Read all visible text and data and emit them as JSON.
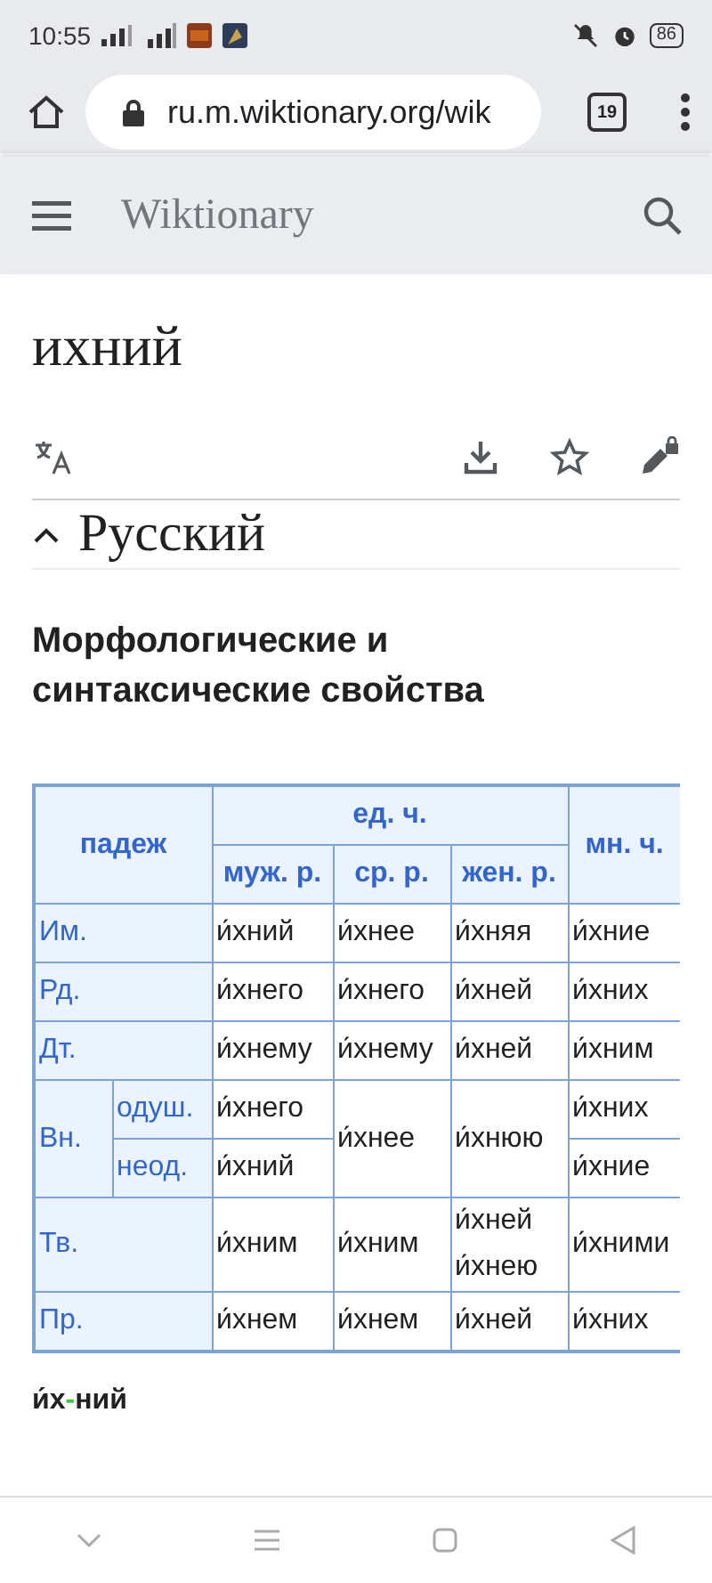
{
  "status_bar": {
    "time": "10:55",
    "battery": "86"
  },
  "browser": {
    "url": "ru.m.wiktionary.org/wik",
    "tab_count": "19"
  },
  "site_header": {
    "title": "Wiktionary"
  },
  "page": {
    "title": "ихний"
  },
  "section": {
    "title": "Русский",
    "expanded": true
  },
  "heading": "Морфологические и синтаксические свойства",
  "table": {
    "rows": [
      [
        {
          "kind": "head",
          "text": "падеж",
          "rowspan": 2,
          "colspan": 2
        },
        {
          "kind": "head",
          "text": "ед. ч.",
          "colspan": 3
        },
        {
          "kind": "head",
          "text": "мн. ч.",
          "rowspan": 2
        }
      ],
      [
        {
          "kind": "head",
          "text": "муж. р."
        },
        {
          "kind": "head",
          "text": "ср. р."
        },
        {
          "kind": "head",
          "text": "жен. р."
        }
      ],
      [
        {
          "kind": "case",
          "text": "Им.",
          "colspan": 2
        },
        {
          "kind": "form",
          "text": "и́хний"
        },
        {
          "kind": "form",
          "text": "и́хнее"
        },
        {
          "kind": "form",
          "text": "и́хняя"
        },
        {
          "kind": "form",
          "text": "и́хние"
        }
      ],
      [
        {
          "kind": "case",
          "text": "Рд.",
          "colspan": 2
        },
        {
          "kind": "form",
          "text": "и́хнего"
        },
        {
          "kind": "form",
          "text": "и́хнего"
        },
        {
          "kind": "form",
          "text": "и́хней"
        },
        {
          "kind": "form",
          "text": "и́хних"
        }
      ],
      [
        {
          "kind": "case",
          "text": "Дт.",
          "colspan": 2
        },
        {
          "kind": "form",
          "text": "и́хнему"
        },
        {
          "kind": "form",
          "text": "и́хнему"
        },
        {
          "kind": "form",
          "text": "и́хней"
        },
        {
          "kind": "form",
          "text": "и́хним"
        }
      ],
      [
        {
          "kind": "case",
          "text": "Вн.",
          "rowspan": 2
        },
        {
          "kind": "case",
          "text": "одуш."
        },
        {
          "kind": "form",
          "text": "и́хнего"
        },
        {
          "kind": "form",
          "text": "и́хнее",
          "rowspan": 2
        },
        {
          "kind": "form",
          "text": "и́хнюю",
          "rowspan": 2
        },
        {
          "kind": "form",
          "text": "и́хних"
        }
      ],
      [
        {
          "kind": "case",
          "text": "неод."
        },
        {
          "kind": "form",
          "text": "и́хний"
        },
        {
          "kind": "form",
          "text": "и́хние"
        }
      ],
      [
        {
          "kind": "case",
          "text": "Тв.",
          "colspan": 2
        },
        {
          "kind": "form",
          "text": "и́хним"
        },
        {
          "kind": "form",
          "text": "и́хним"
        },
        {
          "kind": "form",
          "lines": [
            "и́хней",
            "и́хнею"
          ]
        },
        {
          "kind": "form",
          "text": "и́хними"
        }
      ],
      [
        {
          "kind": "case",
          "text": "Пр.",
          "colspan": 2
        },
        {
          "kind": "form",
          "text": "и́хнем"
        },
        {
          "kind": "form",
          "text": "и́хнем"
        },
        {
          "kind": "form",
          "text": "и́хней"
        },
        {
          "kind": "form",
          "text": "и́хних"
        }
      ]
    ]
  },
  "hyphenation": {
    "syllables": [
      "и́х",
      "ний"
    ],
    "separator": "-"
  }
}
